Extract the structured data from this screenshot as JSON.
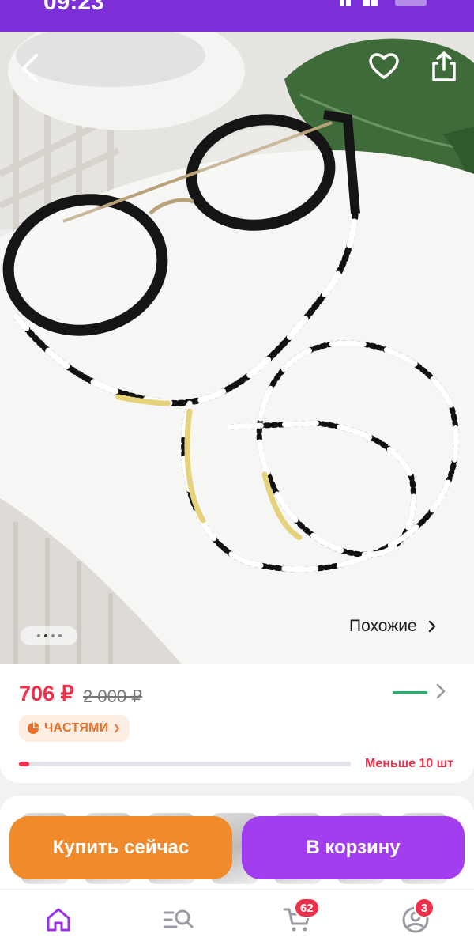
{
  "status": {
    "time": "09:23"
  },
  "similar": {
    "label": "Похожие"
  },
  "gallery": {
    "total": 4,
    "active": 2
  },
  "price": {
    "current": "706 ₽",
    "old": "2 000 ₽"
  },
  "installments": {
    "label": "ЧАСТЯМИ"
  },
  "stock": {
    "label": "Меньше 10 шт",
    "level": 0.03
  },
  "actions": {
    "buy_now": "Купить сейчас",
    "add_to_cart": "В корзину"
  },
  "tabs": {
    "cart_count": "62",
    "profile_count": "3"
  },
  "colors": {
    "brand": "#7c2fd6",
    "price": "#f0304a",
    "buy": "#f08a2a",
    "cart": "#a33ef0"
  },
  "icons": [
    "back-icon",
    "heart-icon",
    "share-icon",
    "chevron-right-icon",
    "installments-icon",
    "home-icon",
    "catalog-search-icon",
    "cart-icon",
    "profile-icon"
  ]
}
